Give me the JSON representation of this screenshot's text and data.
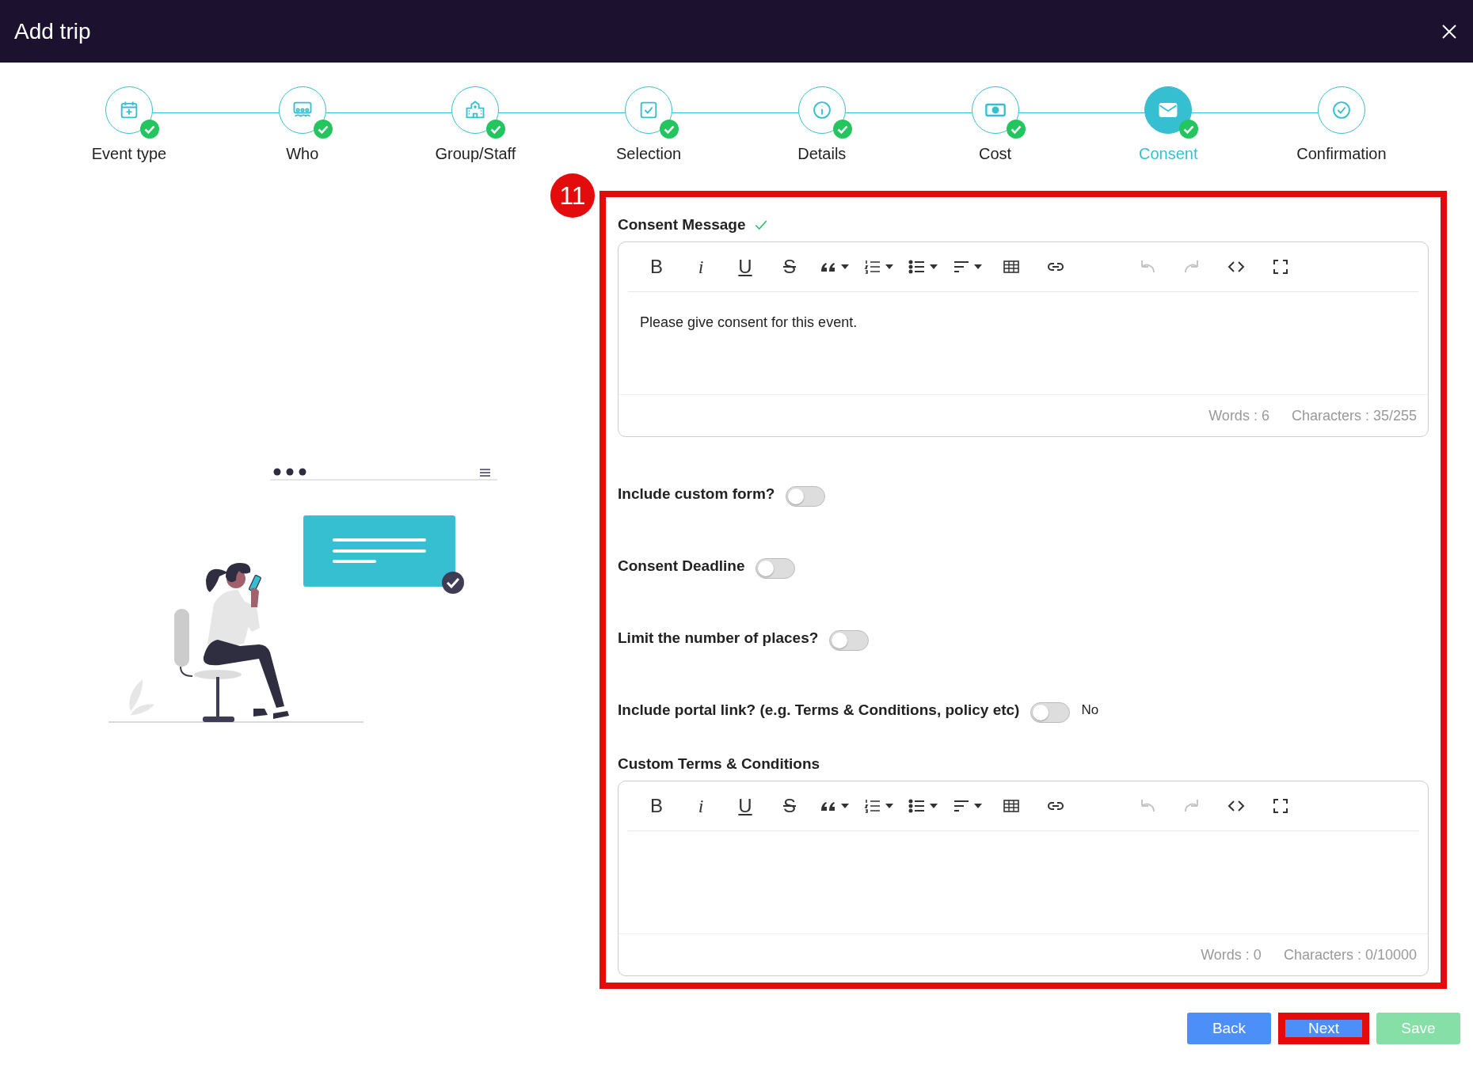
{
  "window": {
    "title": "Add trip"
  },
  "steps": [
    {
      "label": "Event type",
      "completed": true,
      "selected": false
    },
    {
      "label": "Who",
      "completed": true,
      "selected": false
    },
    {
      "label": "Group/Staff",
      "completed": true,
      "selected": false
    },
    {
      "label": "Selection",
      "completed": true,
      "selected": false
    },
    {
      "label": "Details",
      "completed": true,
      "selected": false
    },
    {
      "label": "Cost",
      "completed": true,
      "selected": false
    },
    {
      "label": "Consent",
      "completed": true,
      "selected": true
    },
    {
      "label": "Confirmation",
      "completed": false,
      "selected": false
    }
  ],
  "annotation": {
    "number": "11"
  },
  "consent_message": {
    "label": "Consent Message",
    "valid": true,
    "content": "Please give consent for this event.",
    "words": "Words : 6",
    "characters": "Characters : 35/255",
    "toolbar": [
      {
        "kind": "bold",
        "label": "B",
        "dropdown": false,
        "disabled": false
      },
      {
        "kind": "italic",
        "label": "i",
        "dropdown": false,
        "disabled": false
      },
      {
        "kind": "underline",
        "label": "U",
        "dropdown": false,
        "disabled": false
      },
      {
        "kind": "strike",
        "label": "S",
        "dropdown": false,
        "disabled": false
      },
      {
        "kind": "quote",
        "dropdown": true,
        "disabled": false
      },
      {
        "kind": "ordered",
        "dropdown": true,
        "disabled": false
      },
      {
        "kind": "bullets",
        "dropdown": true,
        "disabled": false
      },
      {
        "kind": "align",
        "dropdown": true,
        "disabled": false
      },
      {
        "kind": "table",
        "dropdown": false,
        "disabled": false
      },
      {
        "kind": "link",
        "dropdown": false,
        "disabled": false
      },
      {
        "kind": "undo",
        "dropdown": false,
        "disabled": true
      },
      {
        "kind": "redo",
        "dropdown": false,
        "disabled": true
      },
      {
        "kind": "code",
        "dropdown": false,
        "disabled": false
      },
      {
        "kind": "fullscreen",
        "dropdown": false,
        "disabled": false
      }
    ]
  },
  "toggles": [
    {
      "label": "Include custom form?",
      "on": false
    },
    {
      "label": "Consent Deadline",
      "on": false
    },
    {
      "label": "Limit the number of places?",
      "on": false
    },
    {
      "label": "Include portal link? (e.g. Terms & Conditions, policy etc)",
      "on": false,
      "state_text": "No"
    }
  ],
  "custom_terms": {
    "label": "Custom Terms & Conditions",
    "words": "Words : 0",
    "characters": "Characters : 0/10000",
    "toolbar": [
      {
        "kind": "bold",
        "label": "B",
        "dropdown": false,
        "disabled": false
      },
      {
        "kind": "italic",
        "label": "i",
        "dropdown": false,
        "disabled": false
      },
      {
        "kind": "underline",
        "label": "U",
        "dropdown": false,
        "disabled": false
      },
      {
        "kind": "strike",
        "label": "S",
        "dropdown": false,
        "disabled": false
      },
      {
        "kind": "quote",
        "dropdown": true,
        "disabled": false
      },
      {
        "kind": "ordered",
        "dropdown": true,
        "disabled": false
      },
      {
        "kind": "bullets",
        "dropdown": true,
        "disabled": false
      },
      {
        "kind": "align",
        "dropdown": true,
        "disabled": false
      },
      {
        "kind": "table",
        "dropdown": false,
        "disabled": false
      },
      {
        "kind": "link",
        "dropdown": false,
        "disabled": false
      },
      {
        "kind": "undo",
        "dropdown": false,
        "disabled": true
      },
      {
        "kind": "redo",
        "dropdown": false,
        "disabled": true
      },
      {
        "kind": "code",
        "dropdown": false,
        "disabled": false
      },
      {
        "kind": "fullscreen",
        "dropdown": false,
        "disabled": false
      }
    ]
  },
  "buttons": [
    {
      "kind": "back",
      "label": "Back",
      "highlighted": false,
      "disabled": false
    },
    {
      "kind": "next",
      "label": "Next",
      "highlighted": true,
      "disabled": false
    },
    {
      "kind": "save",
      "label": "Save",
      "highlighted": false,
      "disabled": true
    }
  ]
}
